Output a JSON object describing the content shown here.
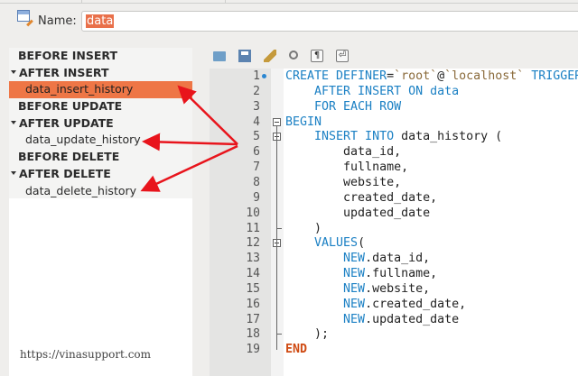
{
  "name_field": {
    "label": "Name:",
    "value": "data"
  },
  "trigger_tree": [
    {
      "label": "BEFORE INSERT",
      "expanded": false
    },
    {
      "label": "AFTER INSERT",
      "expanded": true,
      "child": "data_insert_history",
      "selected": true
    },
    {
      "label": "BEFORE UPDATE",
      "expanded": false
    },
    {
      "label": "AFTER UPDATE",
      "expanded": true,
      "child": "data_update_history"
    },
    {
      "label": "BEFORE DELETE",
      "expanded": false
    },
    {
      "label": "AFTER DELETE",
      "expanded": true,
      "child": "data_delete_history"
    }
  ],
  "toolbar": [
    "open-file-icon",
    "save-icon",
    "beautify-broom-icon",
    "find-icon",
    "invisible-chars-icon",
    "word-wrap-icon"
  ],
  "toolbar_glyphs": {
    "para": "¶",
    "wrap": "⏎"
  },
  "editor": {
    "lines": [
      [
        [
          "CREATE DEFINER",
          "kw"
        ],
        [
          "=",
          ""
        ],
        [
          "`root`",
          "str"
        ],
        [
          "@",
          ""
        ],
        [
          "`localhost`",
          "str"
        ],
        [
          " TRIGGER",
          "kw"
        ]
      ],
      [
        [
          "    AFTER INSERT ON data",
          "kw"
        ]
      ],
      [
        [
          "    FOR EACH ROW",
          "kw"
        ]
      ],
      [
        [
          "BEGIN",
          "kw"
        ]
      ],
      [
        [
          "    INSERT INTO ",
          "kw"
        ],
        [
          "data_history (",
          ""
        ]
      ],
      [
        [
          "        data_id,",
          ""
        ]
      ],
      [
        [
          "        fullname,",
          ""
        ]
      ],
      [
        [
          "        website,",
          ""
        ]
      ],
      [
        [
          "        created_date,",
          ""
        ]
      ],
      [
        [
          "        updated_date",
          ""
        ]
      ],
      [
        [
          "    )",
          ""
        ]
      ],
      [
        [
          "    VALUES",
          "kw"
        ],
        [
          "(",
          ""
        ]
      ],
      [
        [
          "        ",
          ""
        ],
        [
          "NEW",
          "kw"
        ],
        [
          ".data_id,",
          ""
        ]
      ],
      [
        [
          "        ",
          ""
        ],
        [
          "NEW",
          "kw"
        ],
        [
          ".fullname,",
          ""
        ]
      ],
      [
        [
          "        ",
          ""
        ],
        [
          "NEW",
          "kw"
        ],
        [
          ".website,",
          ""
        ]
      ],
      [
        [
          "        ",
          ""
        ],
        [
          "NEW",
          "kw"
        ],
        [
          ".created_date,",
          ""
        ]
      ],
      [
        [
          "        ",
          ""
        ],
        [
          "NEW",
          "kw"
        ],
        [
          ".updated_date",
          ""
        ]
      ],
      [
        [
          "    );",
          ""
        ]
      ],
      [
        [
          "END",
          "end"
        ]
      ]
    ]
  },
  "watermark": "https://vinasupport.com",
  "colors": {
    "selection": "#ee7646",
    "keyword": "#1b80c4",
    "arrow": "#e8141c"
  }
}
